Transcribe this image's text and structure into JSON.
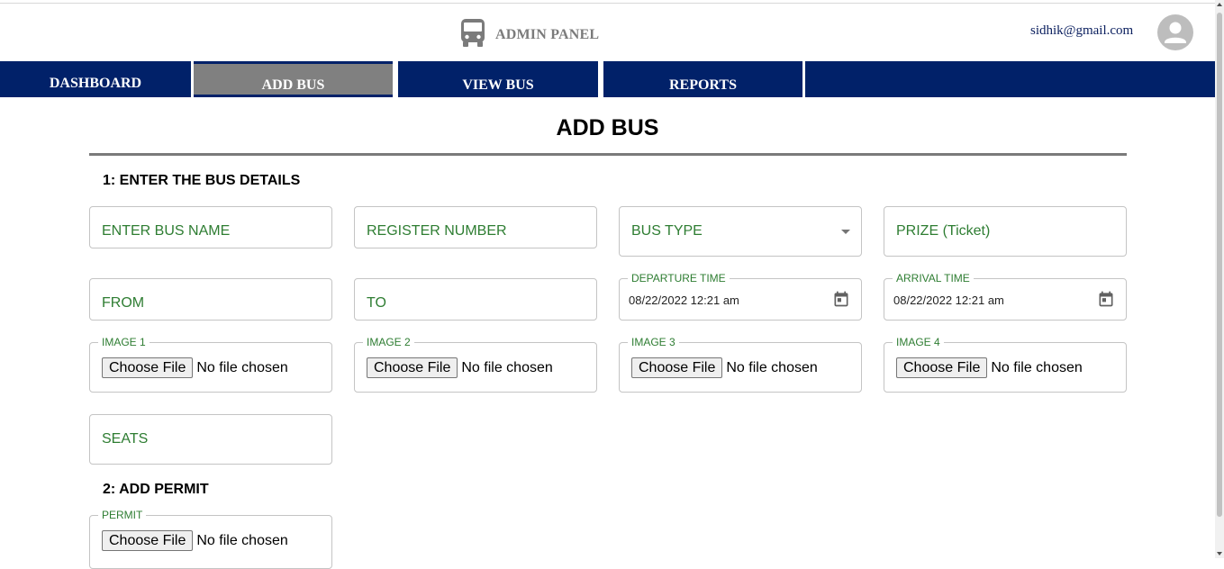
{
  "header": {
    "brand_title": "ADMIN PANEL",
    "brand_icon": "bus-icon",
    "user_email": "sidhik@gmail.com",
    "avatar_icon": "user-avatar-icon"
  },
  "nav": {
    "tabs": [
      {
        "label": "DASHBOARD",
        "active": false
      },
      {
        "label": "ADD BUS",
        "active": true
      },
      {
        "label": "VIEW BUS",
        "active": false
      },
      {
        "label": "REPORTS",
        "active": false
      }
    ]
  },
  "page": {
    "title": "ADD BUS"
  },
  "section1": {
    "title": "1: ENTER THE BUS DETAILS",
    "bus_name_placeholder": "ENTER BUS NAME",
    "register_number_placeholder": "REGISTER NUMBER",
    "bus_type_placeholder": "BUS TYPE",
    "prize_placeholder": "PRIZE (Ticket)",
    "from_placeholder": "FROM",
    "to_placeholder": "TO",
    "departure_label": "DEPARTURE TIME",
    "departure_value": "08/22/2022 12:21 am",
    "arrival_label": "ARRIVAL TIME",
    "arrival_value": "08/22/2022 12:21 am",
    "images": [
      {
        "label": "IMAGE 1",
        "button": "Choose File",
        "status": "No file chosen"
      },
      {
        "label": "IMAGE 2",
        "button": "Choose File",
        "status": "No file chosen"
      },
      {
        "label": "IMAGE 3",
        "button": "Choose File",
        "status": "No file chosen"
      },
      {
        "label": "IMAGE 4",
        "button": "Choose File",
        "status": "No file chosen"
      }
    ],
    "seats_placeholder": "SEATS"
  },
  "section2": {
    "title": "2: ADD PERMIT",
    "permit_label": "PERMIT",
    "permit_button": "Choose File",
    "permit_status": "No file chosen"
  },
  "colors": {
    "nav_background": "#012169",
    "active_tab": "#808080",
    "field_text": "#2e7d32",
    "email_text": "#0d2160"
  }
}
